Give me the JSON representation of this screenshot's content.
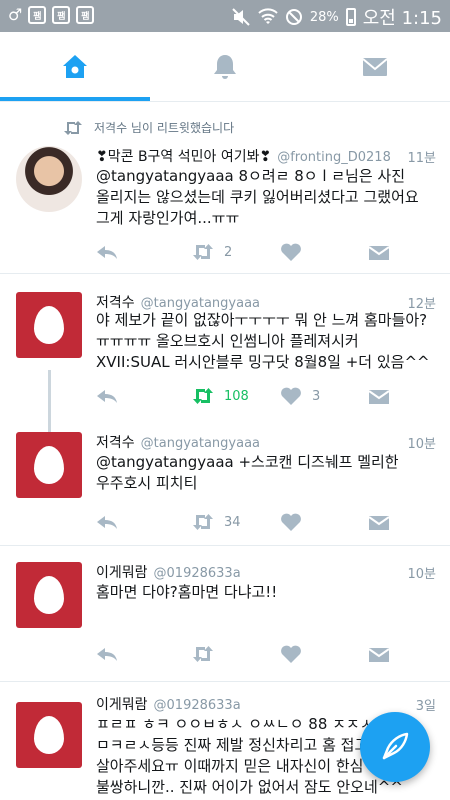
{
  "status_bar": {
    "app_icons": [
      "팸",
      "팸",
      "팸"
    ],
    "battery": "28%",
    "time": "오전 1:15"
  },
  "tabs": [
    {
      "name": "home",
      "icon": "home-icon",
      "active": true
    },
    {
      "name": "notifications",
      "icon": "bell-icon",
      "active": false
    },
    {
      "name": "messages",
      "icon": "envelope-icon",
      "active": false
    }
  ],
  "colors": {
    "accent": "#1da1f2",
    "retweet_active": "#17bf63",
    "egg_avatar": "#c12a37",
    "muted": "#8899a6"
  },
  "tweets": [
    {
      "context": "저격수 님이 리트윗했습니다",
      "display_name": "❣막콘 B구역 석민아 여기봐❣",
      "handle": "@fronting_D0218",
      "time": "11분",
      "text": "@tangyatangyaaa 8ㅇ려ㄹ 8ㅇ l ㄹ님은 사진 올리지는 않으셨는데 쿠키 잃어버리셨다고 그랬어요 그게 자랑인가여...ㅠㅠ",
      "retweets": "2",
      "likes": ""
    },
    {
      "display_name": "저격수",
      "handle": "@tangyatangyaaa",
      "time": "12분",
      "text": "야 제보가 끝이 없잖아ㅜㅜㅜㅜ 뭐 안 느껴 홈마들아?ㅠㅠㅠㅠ 올오브호시 인썸니아 플레져시커 XVII:SUAL 러시안블루 밍구닷 8월8일 +더 있음^^",
      "retweets": "108",
      "likes": "3"
    },
    {
      "display_name": "저격수",
      "handle": "@tangyatangyaaa",
      "time": "10분",
      "text": "@tangyatangyaaa +스코캔 디즈눼프 멜리한 우주호시 피치티",
      "retweets": "34",
      "likes": ""
    },
    {
      "display_name": "이게뭐람",
      "handle": "@01928633a",
      "time": "10분",
      "text": "홈마면 다야?홈마면 다냐고!!",
      "retweets": "",
      "likes": ""
    },
    {
      "display_name": "이게뭐람",
      "handle": "@01928633a",
      "time": "3일",
      "text": "ㅍㄹㅍ ㅎㅋ ㅇㅇㅂㅎㅅ ㅇㅆㄴㅇ 88 ㅈㅈㅅ ㅁㅋㄹㅅ등등 진짜 제발 정신차리고 홈 접고 불쌍하니깐.. 진짜 어이가 없어서 잠도 안오네^^",
      "text_visible": "ㅍㄹㅍ ㅎㅋ ㅇㅇㅂㅎㅅ ㅇㅆㄴㅇ 88 ㅈㅈㅅ\nㅁㅋㄹㅅ등등 진짜 제발 정신차리고 홈 접고\n살아주세요ㅠ 이때까지 믿은 내자신이 한심\n불쌍하니깐.. 진짜 어이가 없어서 잠도 안오네^^",
      "retweets": "",
      "likes": ""
    }
  ]
}
